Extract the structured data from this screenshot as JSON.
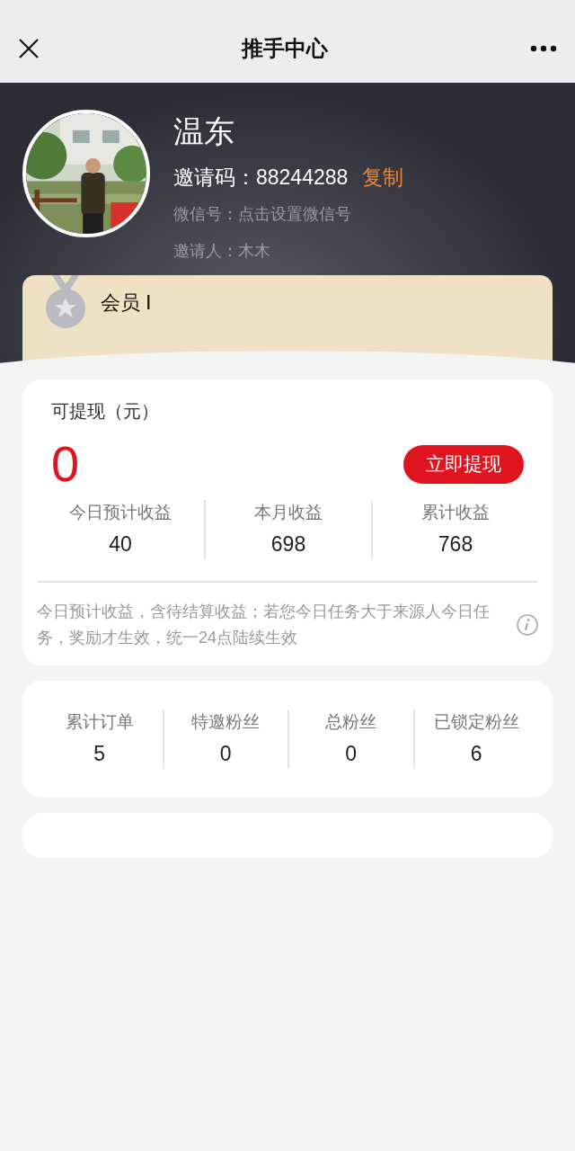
{
  "nav": {
    "title": "推手中心"
  },
  "profile": {
    "name": "温东",
    "invite_label": "邀请码：",
    "invite_code": "88244288",
    "copy_link": "复制",
    "wechat": "微信号：点击设置微信号",
    "inviter": "邀请人：木木"
  },
  "member": {
    "level": "会员 Ⅰ"
  },
  "withdraw": {
    "label": "可提现（元）",
    "amount": "0",
    "button": "立即提现"
  },
  "earnings": [
    {
      "label": "今日预计收益",
      "value": "40"
    },
    {
      "label": "本月收益",
      "value": "698"
    },
    {
      "label": "累计收益",
      "value": "768"
    }
  ],
  "note": "今日预计收益，含待结算收益；若您今日任务大于来源人今日任务，奖励才生效，统一24点陆续生效",
  "counts": [
    {
      "label": "累计订单",
      "value": "5"
    },
    {
      "label": "特邀粉丝",
      "value": "0"
    },
    {
      "label": "总粉丝",
      "value": "0"
    },
    {
      "label": "已锁定粉丝",
      "value": "6"
    }
  ]
}
